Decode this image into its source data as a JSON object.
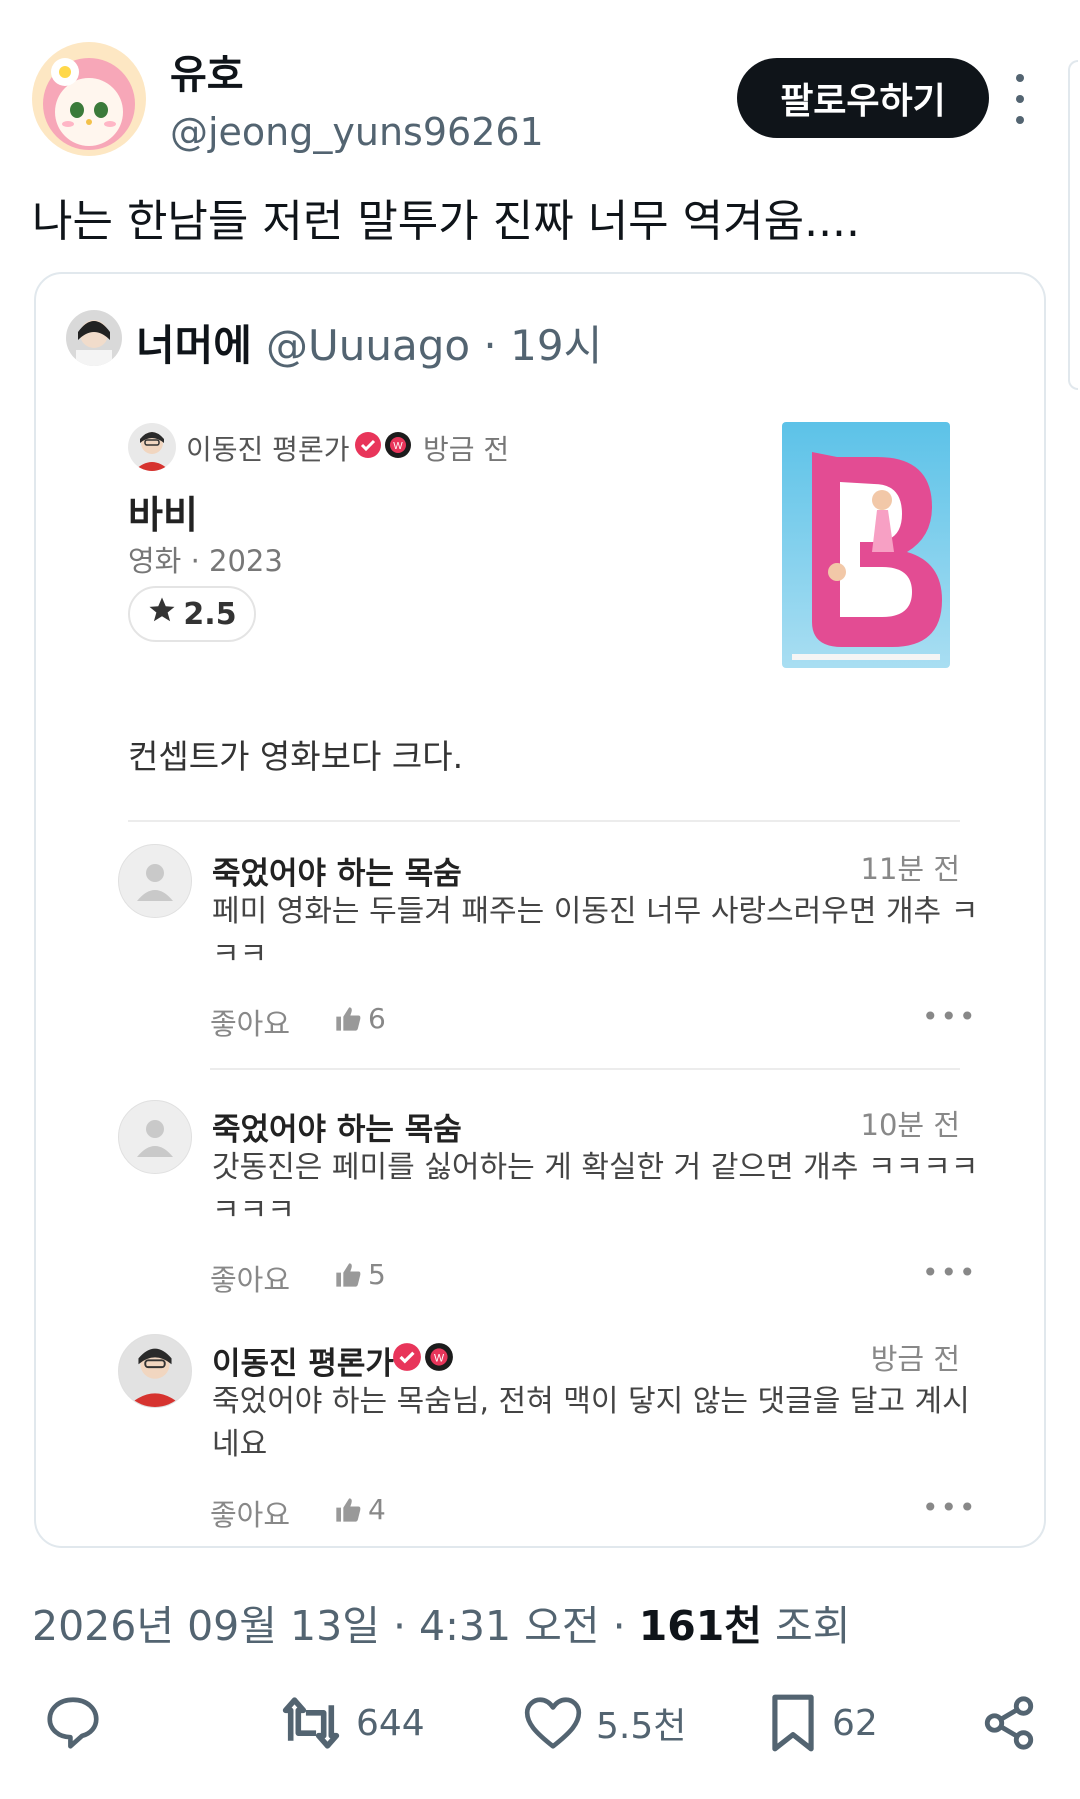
{
  "tweet": {
    "display_name": "유호",
    "handle": "@jeong_yuns96261",
    "follow_label": "팔로우하기",
    "text": "나는 한남들 저런 말투가 진짜 너무 역겨움....",
    "date": "2026년 09월 13일",
    "time": "4:31 오전",
    "views_count": "161천",
    "views_label": "조회"
  },
  "quote": {
    "display_name": "너머에",
    "handle": "@Uuuago",
    "time": "19시"
  },
  "review": {
    "author": "이동진 평론가",
    "time": "방금 전",
    "title": "바비",
    "meta": "영화 · 2023",
    "rating": "2.5",
    "text": "컨셉트가 영화보다 크다."
  },
  "comments": [
    {
      "author": "죽었어야 하는 목숨",
      "time": "11분 전",
      "text": "페미 영화는 두들겨 패주는 이동진 너무 사랑스러우면 개추 ㅋㅋㅋ",
      "like_label": "좋아요",
      "likes": "6"
    },
    {
      "author": "죽었어야 하는 목숨",
      "time": "10분 전",
      "text": "갓동진은 페미를 싫어하는 게 확실한 거 같으면 개추 ㅋㅋㅋㅋㅋㅋㅋ",
      "like_label": "좋아요",
      "likes": "5"
    },
    {
      "author": "이동진 평론가",
      "time": "방금 전",
      "text": "죽었어야 하는 목숨님, 전혀 맥이 닿지 않는 댓글을 달고 계시네요",
      "like_label": "좋아요",
      "likes": "4"
    }
  ],
  "actions": {
    "reply_icon": "speech-bubble",
    "retweets": "644",
    "likes": "5.5천",
    "bookmarks": "62"
  },
  "colors": {
    "text": "#0f1419",
    "secondary": "#536471",
    "follow_bg": "#0f1419",
    "verified": "#e8355a",
    "border": "#e1e8ed"
  }
}
